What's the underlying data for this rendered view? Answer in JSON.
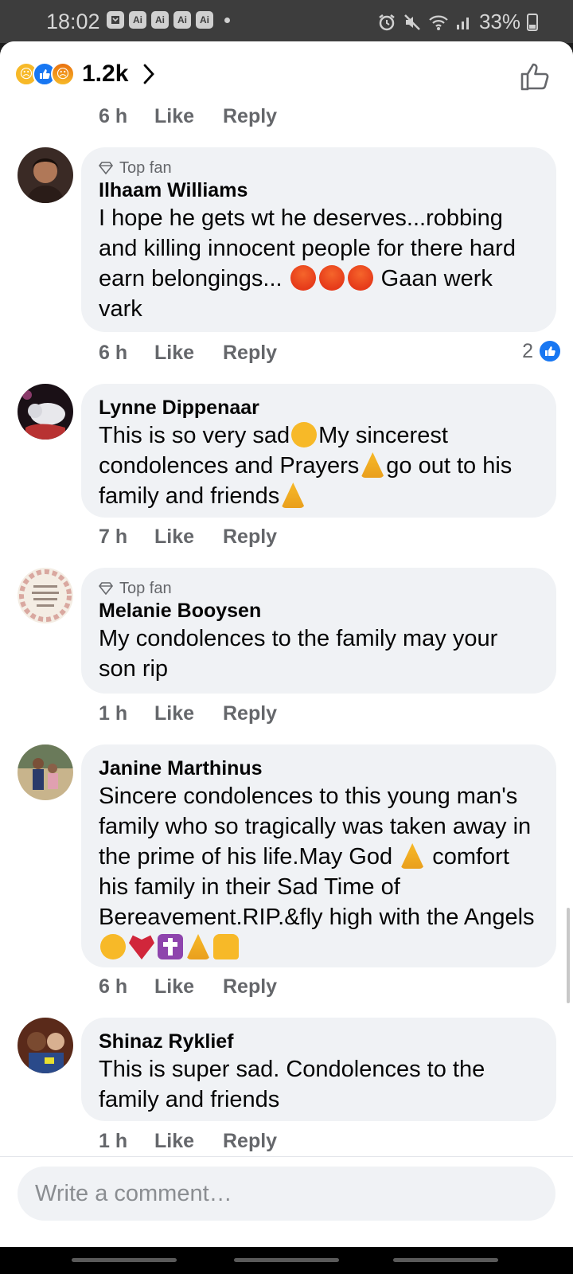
{
  "status_bar": {
    "time": "18:02",
    "app_icons": [
      "Ai",
      "Ai",
      "Ai",
      "Ai"
    ],
    "battery": "33%"
  },
  "reactions": {
    "icons": [
      "sad-icon",
      "like-icon",
      "angry-icon"
    ],
    "count": "1.2k"
  },
  "previous_comment_meta": {
    "time": "6 h",
    "like": "Like",
    "reply": "Reply"
  },
  "comments": [
    {
      "top_fan": "Top fan",
      "author": "Ilhaam Williams",
      "text_parts": [
        "I hope he gets wt he deserves...robbing and killing innocent people for there hard earn belongings... ",
        " Gaan werk vark"
      ],
      "time": "6 h",
      "like": "Like",
      "reply": "Reply",
      "like_count": "2"
    },
    {
      "author": "Lynne Dippenaar",
      "text_parts": [
        "This is so very sad",
        "My sincerest condolences and Prayers",
        "go out to his family and friends"
      ],
      "time": "7 h",
      "like": "Like",
      "reply": "Reply"
    },
    {
      "top_fan": "Top fan",
      "author": "Melanie Booysen",
      "text": "My condolences to the family may your son rip",
      "time": "1 h",
      "like": "Like",
      "reply": "Reply"
    },
    {
      "author": "Janine Marthinus",
      "text_parts": [
        "Sincere condolences to this young man's family who so tragically was taken away in the prime of his life.May God ",
        " comfort his family in their Sad Time of Bereavement.RIP.&fly high with the Angels"
      ],
      "time": "6 h",
      "like": "Like",
      "reply": "Reply"
    },
    {
      "author": "Shinaz Ryklief",
      "text": "This is super sad. Condolences to the family and friends",
      "time": "1 h",
      "like": "Like",
      "reply": "Reply"
    }
  ],
  "composer": {
    "placeholder": "Write a comment…"
  },
  "colors": {
    "accent": "#1877f2",
    "bubble": "#f0f2f5",
    "meta_text": "#65676b"
  }
}
